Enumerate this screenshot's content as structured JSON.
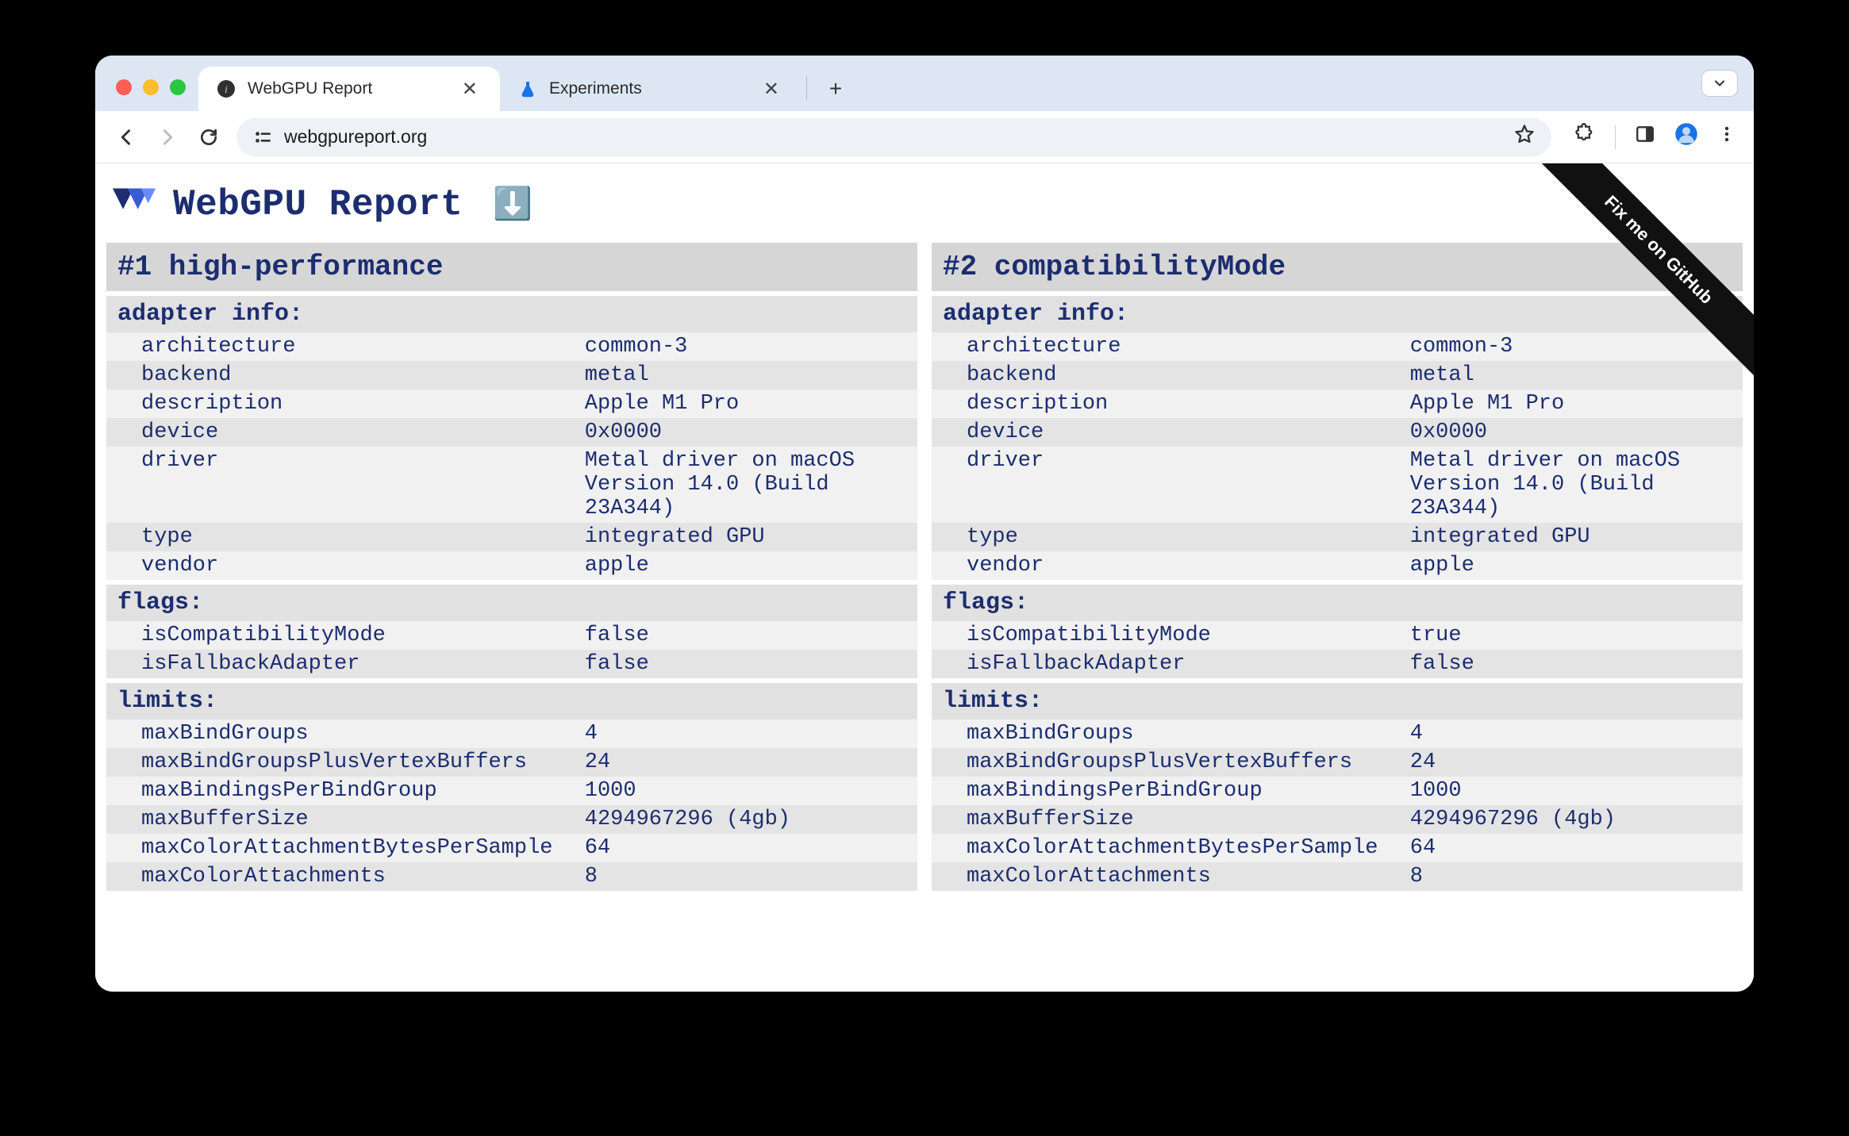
{
  "browser": {
    "tabs": [
      {
        "title": "WebGPU Report",
        "active": true
      },
      {
        "title": "Experiments",
        "active": false
      }
    ],
    "url": "webgpureport.org"
  },
  "page": {
    "title": "WebGPU Report",
    "ribbon": "Fix me on GitHub"
  },
  "adapters": [
    {
      "heading": "#1 high-performance",
      "sections": [
        {
          "title": "adapter info:",
          "rows": [
            {
              "k": "architecture",
              "v": "common-3"
            },
            {
              "k": "backend",
              "v": "metal"
            },
            {
              "k": "description",
              "v": "Apple M1 Pro"
            },
            {
              "k": "device",
              "v": "0x0000"
            },
            {
              "k": "driver",
              "v": "Metal driver on macOS Version 14.0 (Build 23A344)"
            },
            {
              "k": "type",
              "v": "integrated GPU"
            },
            {
              "k": "vendor",
              "v": "apple"
            }
          ]
        },
        {
          "title": "flags:",
          "rows": [
            {
              "k": "isCompatibilityMode",
              "v": "false"
            },
            {
              "k": "isFallbackAdapter",
              "v": "false"
            }
          ]
        },
        {
          "title": "limits:",
          "rows": [
            {
              "k": "maxBindGroups",
              "v": "4"
            },
            {
              "k": "maxBindGroupsPlusVertexBuffers",
              "v": "24"
            },
            {
              "k": "maxBindingsPerBindGroup",
              "v": "1000"
            },
            {
              "k": "maxBufferSize",
              "v": "4294967296 (4gb)",
              "hl": true
            },
            {
              "k": "maxColorAttachmentBytesPerSample",
              "v": "64",
              "hl": true
            },
            {
              "k": "maxColorAttachments",
              "v": "8"
            }
          ]
        }
      ]
    },
    {
      "heading": "#2 compatibilityMode",
      "sections": [
        {
          "title": "adapter info:",
          "rows": [
            {
              "k": "architecture",
              "v": "common-3"
            },
            {
              "k": "backend",
              "v": "metal"
            },
            {
              "k": "description",
              "v": "Apple M1 Pro"
            },
            {
              "k": "device",
              "v": "0x0000"
            },
            {
              "k": "driver",
              "v": "Metal driver on macOS Version 14.0 (Build 23A344)"
            },
            {
              "k": "type",
              "v": "integrated GPU"
            },
            {
              "k": "vendor",
              "v": "apple"
            }
          ]
        },
        {
          "title": "flags:",
          "rows": [
            {
              "k": "isCompatibilityMode",
              "v": "true"
            },
            {
              "k": "isFallbackAdapter",
              "v": "false"
            }
          ]
        },
        {
          "title": "limits:",
          "rows": [
            {
              "k": "maxBindGroups",
              "v": "4"
            },
            {
              "k": "maxBindGroupsPlusVertexBuffers",
              "v": "24"
            },
            {
              "k": "maxBindingsPerBindGroup",
              "v": "1000"
            },
            {
              "k": "maxBufferSize",
              "v": "4294967296 (4gb)",
              "hl": true
            },
            {
              "k": "maxColorAttachmentBytesPerSample",
              "v": "64",
              "hl": true
            },
            {
              "k": "maxColorAttachments",
              "v": "8"
            }
          ]
        }
      ]
    }
  ]
}
